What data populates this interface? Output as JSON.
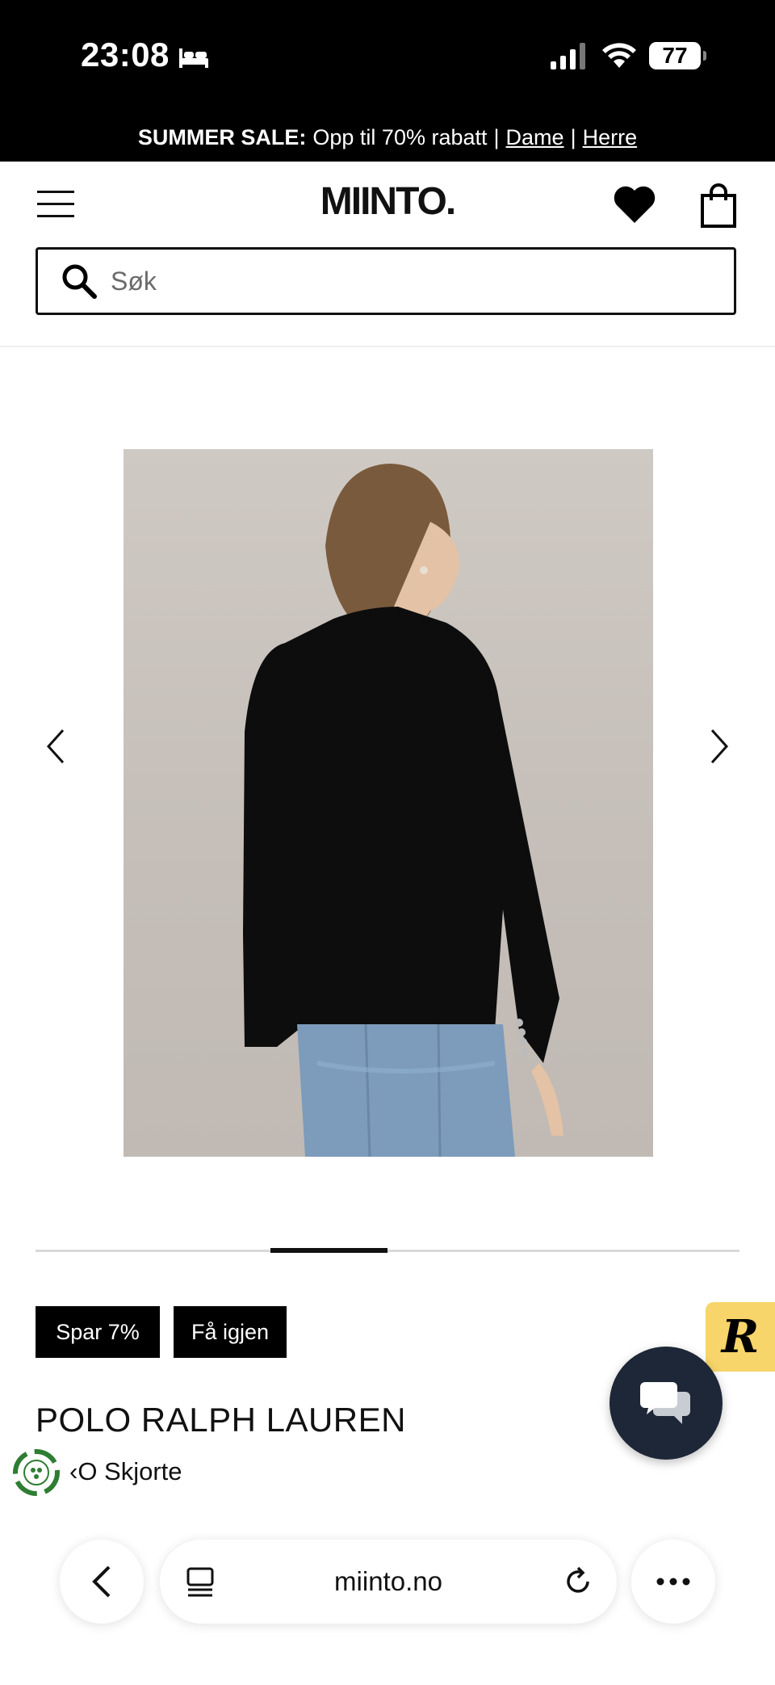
{
  "status_bar": {
    "time": "23:08",
    "battery": "77",
    "icons": [
      "bed-icon",
      "signal-icon",
      "wifi-icon",
      "battery-icon"
    ]
  },
  "promo": {
    "label": "SUMMER SALE:",
    "text": "Opp til 70% rabatt",
    "separator": "|",
    "link_women": "Dame",
    "link_men": "Herre"
  },
  "header": {
    "logo": "MIINTO.",
    "icons": [
      "menu-icon",
      "heart-icon",
      "shopping-bag-icon"
    ]
  },
  "search": {
    "placeholder": "Søk",
    "icon": "search-icon"
  },
  "product": {
    "image_alt": "Woman wearing black blazer and blue jeans, back view",
    "carousel": {
      "active_index": 3,
      "count": 6
    },
    "badges": {
      "sale": "Spar 7%",
      "return": "Få igjen"
    },
    "brand": "POLO RALPH LAUREN",
    "name": "‹O Skjorte"
  },
  "widgets": {
    "reviews_letter": "R",
    "chat_icon": "chat-bubbles-icon",
    "eco_icon": "recycle-icon"
  },
  "browser": {
    "url": "miinto.no",
    "icons": [
      "chevron-left-icon",
      "tabs-icon",
      "reload-icon",
      "more-icon"
    ]
  },
  "colors": {
    "black": "#000000",
    "chat_bg": "#1d2737",
    "reviews_bg": "#f7d56a",
    "eco_green": "#2e7d32"
  }
}
